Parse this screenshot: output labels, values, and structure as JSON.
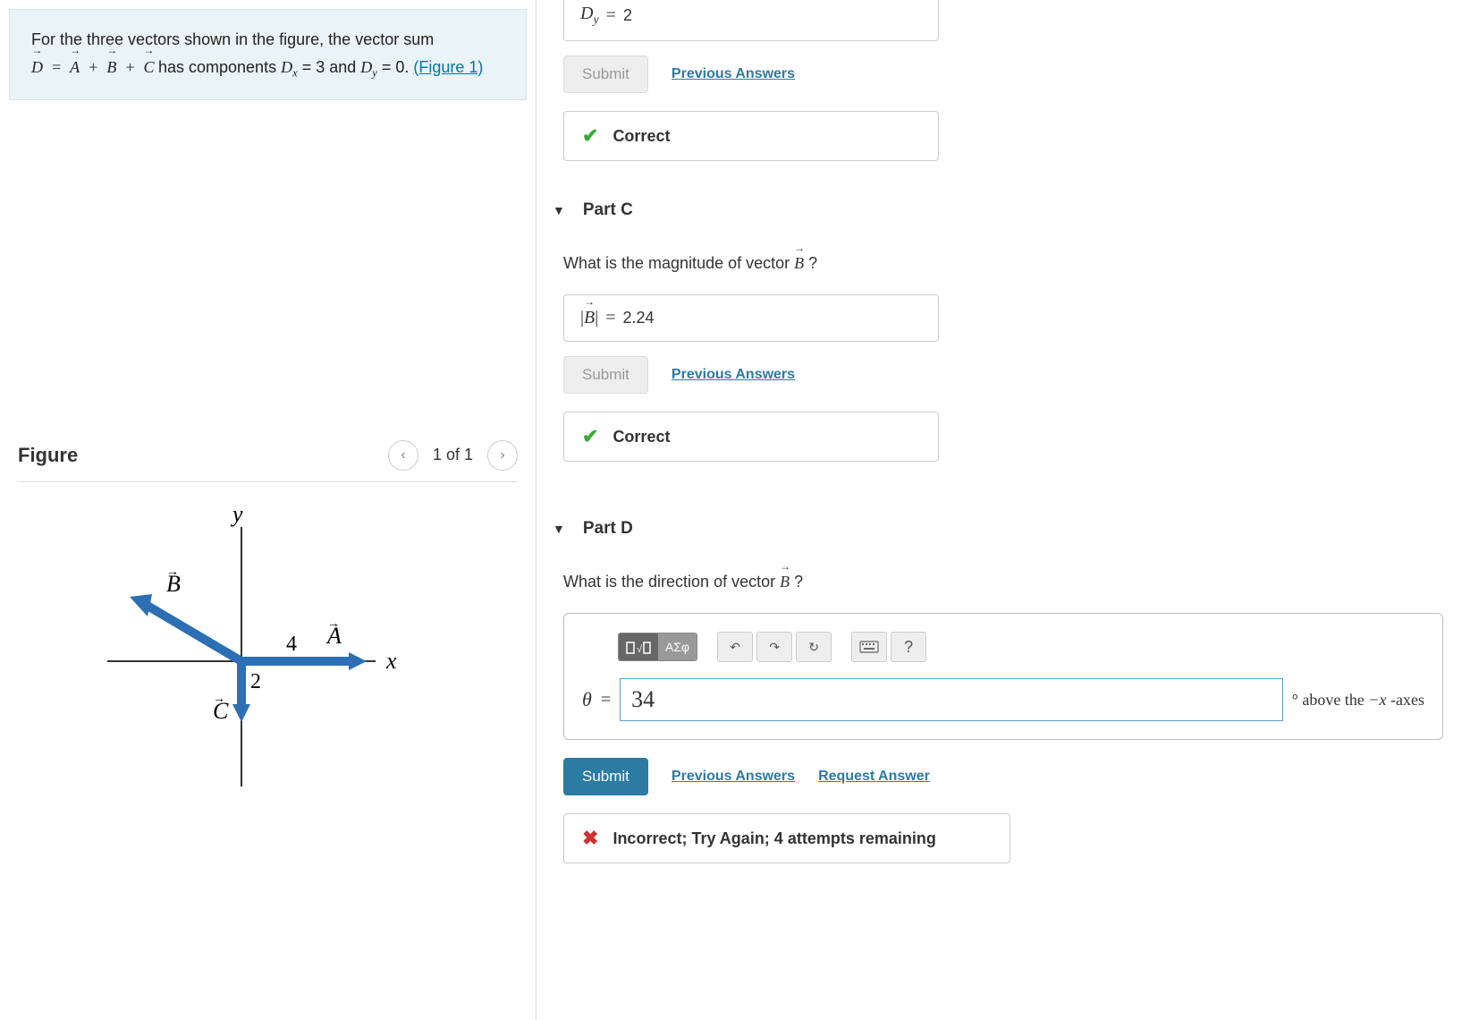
{
  "problem": {
    "intro": "For the three vectors shown in the figure, the vector sum",
    "eqD": "D",
    "eqA": "A",
    "eqB": "B",
    "eqC": "C",
    "eq_plus": "+",
    "eq_has": " has components ",
    "Dx_label": "D",
    "Dx_sub": "x",
    "Dx_eq": " = 3 and ",
    "Dy_label": "D",
    "Dy_sub": "y",
    "Dy_eq": " = 0.",
    "figure_link": "(Figure 1)"
  },
  "figure": {
    "title": "Figure",
    "count": "1 of 1",
    "labels": {
      "y": "y",
      "x": "x",
      "A": "A",
      "B": "B",
      "C": "C",
      "four": "4",
      "two": "2"
    }
  },
  "partB_clip": {
    "eq_text": "Dᵧ = 2",
    "submit": "Submit",
    "prev": "Previous Answers",
    "correct": "Correct"
  },
  "partC": {
    "title": "Part C",
    "question_pre": "What is the magnitude of vector ",
    "question_vec": "B",
    "question_post": "?",
    "answer_label": "|B|",
    "answer_eq": "=",
    "answer_val": "2.24",
    "submit": "Submit",
    "prev": "Previous Answers",
    "correct": "Correct"
  },
  "partD": {
    "title": "Part D",
    "question_pre": "What is the direction of vector ",
    "question_vec": "B",
    "question_post": "?",
    "toolbar": {
      "templates": "▯√▯",
      "greek": "ΑΣφ",
      "undo": "↶",
      "redo": "↷",
      "reset": "↻",
      "keyboard": "⌨",
      "help": "?"
    },
    "theta": "θ",
    "eq": "=",
    "value": "34",
    "unit_deg": "°",
    "unit_suffix_pre": " above the ",
    "unit_suffix_x": "−x",
    "unit_suffix_post": " -axes",
    "submit": "Submit",
    "prev": "Previous Answers",
    "request": "Request Answer",
    "incorrect": "Incorrect; Try Again; 4 attempts remaining"
  }
}
